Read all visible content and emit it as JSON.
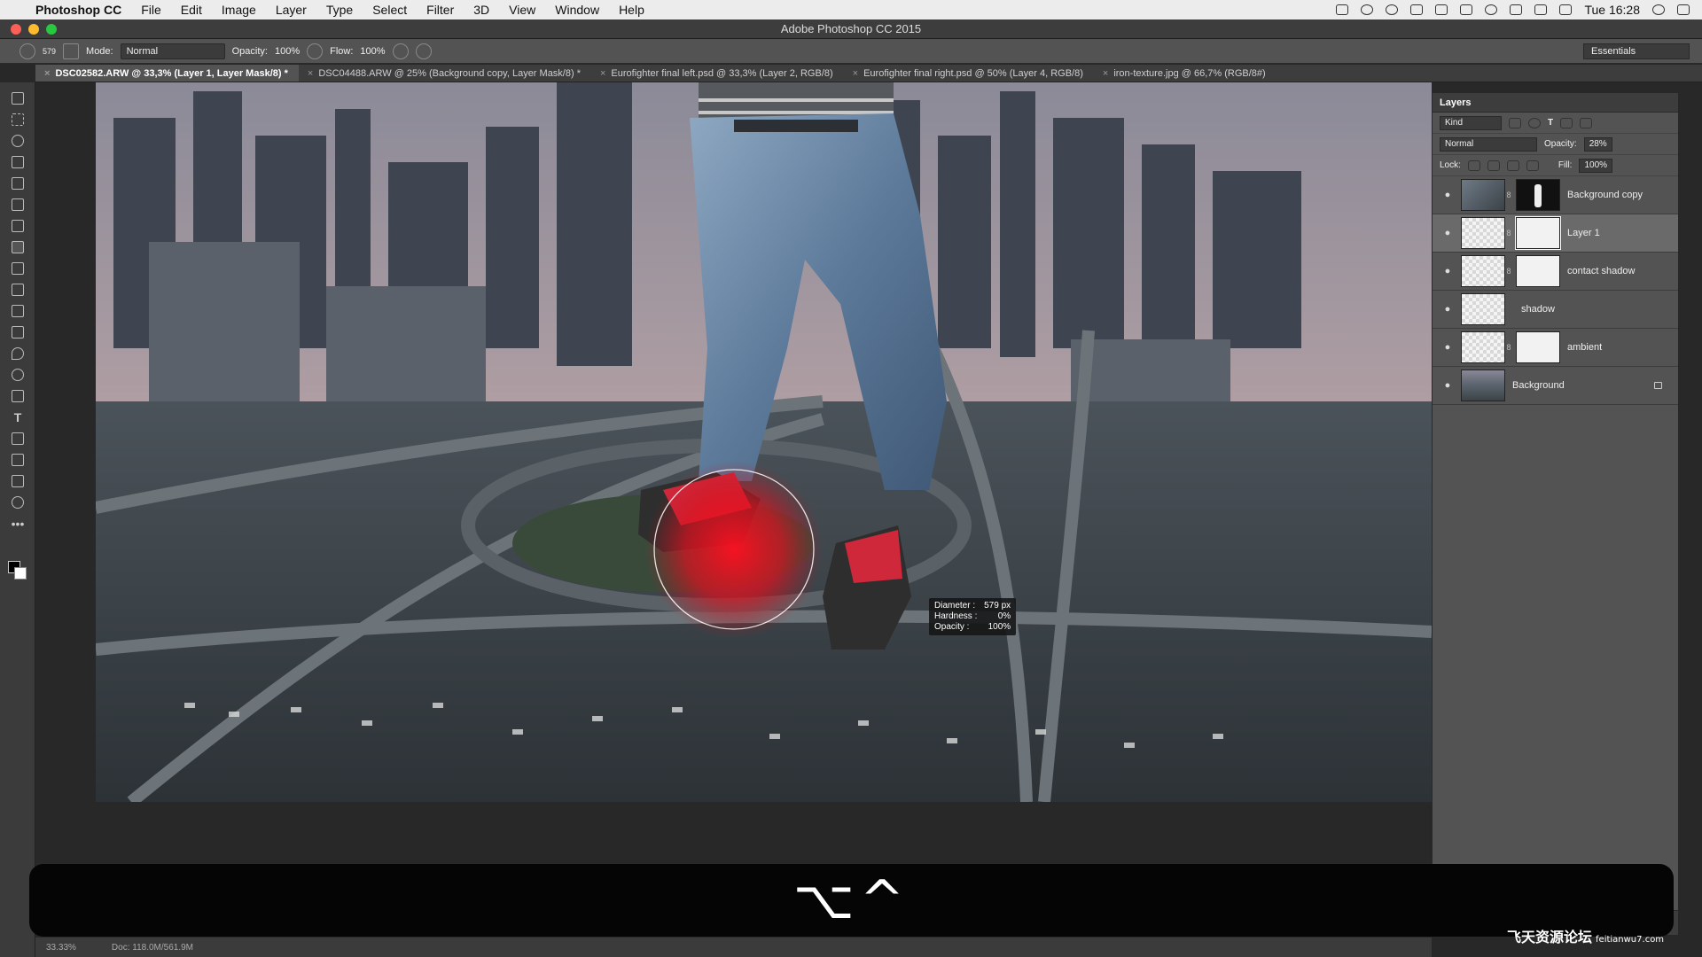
{
  "menubar": {
    "app_name": "Photoshop CC",
    "items": [
      "File",
      "Edit",
      "Image",
      "Layer",
      "Type",
      "Select",
      "Filter",
      "3D",
      "View",
      "Window",
      "Help"
    ],
    "clock": "Tue 16:28"
  },
  "window": {
    "title": "Adobe Photoshop CC 2015"
  },
  "options": {
    "brush_size": "579",
    "mode_label": "Mode:",
    "mode_value": "Normal",
    "opacity_label": "Opacity:",
    "opacity_value": "100%",
    "flow_label": "Flow:",
    "flow_value": "100%",
    "workspace": "Essentials"
  },
  "tabs": [
    "DSC02582.ARW @ 33,3% (Layer 1, Layer Mask/8) *",
    "DSC04488.ARW @ 25% (Background copy, Layer Mask/8) *",
    "Eurofighter final left.psd @ 33,3% (Layer 2, RGB/8)",
    "Eurofighter final right.psd @ 50% (Layer 4, RGB/8)",
    "iron-texture.jpg @ 66,7% (RGB/8#)"
  ],
  "brush_tooltip": {
    "diameter_label": "Diameter :",
    "diameter_value": "579 px",
    "hardness_label": "Hardness :",
    "hardness_value": "0%",
    "opacity_label": "Opacity :",
    "opacity_value": "100%"
  },
  "layers_panel": {
    "title": "Layers",
    "kind": "Kind",
    "blend_mode": "Normal",
    "opacity_label": "Opacity:",
    "opacity_value": "28%",
    "lock_label": "Lock:",
    "fill_label": "Fill:",
    "fill_value": "100%",
    "layers": [
      {
        "name": "Background copy"
      },
      {
        "name": "Layer 1"
      },
      {
        "name": "contact shadow"
      },
      {
        "name": "shadow"
      },
      {
        "name": "ambient"
      },
      {
        "name": "Background"
      }
    ]
  },
  "status": {
    "zoom": "33.33%",
    "doc": "Doc: 118.0M/561.9M"
  },
  "keycast": {
    "keys": "⌥^"
  },
  "watermark": {
    "text": "飞天资源论坛",
    "url": "feitianwu7.com"
  }
}
